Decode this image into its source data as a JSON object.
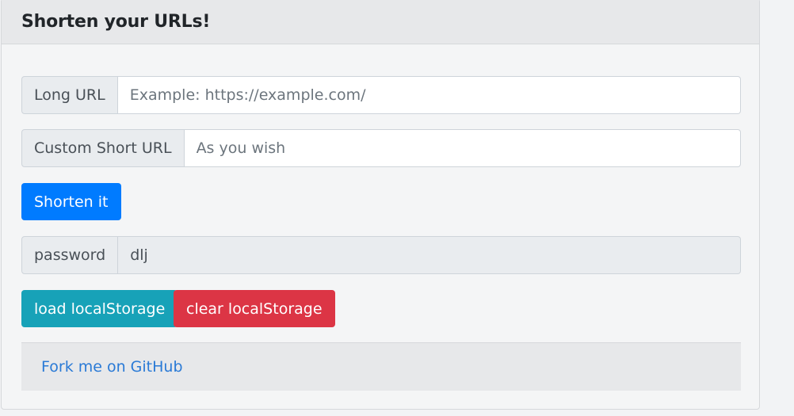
{
  "card": {
    "title": "Shorten your URLs!"
  },
  "long_url": {
    "label": "Long URL",
    "value": "",
    "placeholder": "Example: https://example.com/"
  },
  "custom_short_url": {
    "label": "Custom Short URL",
    "value": "",
    "placeholder": "As you wish"
  },
  "shorten_button": {
    "label": "Shorten it",
    "color": "#007bff"
  },
  "password": {
    "label": "password",
    "value": "dlj"
  },
  "load_button": {
    "label": "load localStorage",
    "color": "#17a2b8"
  },
  "clear_button": {
    "label": "clear localStorage",
    "color": "#dc3545"
  },
  "footer": {
    "link_label": "Fork me on GitHub"
  }
}
